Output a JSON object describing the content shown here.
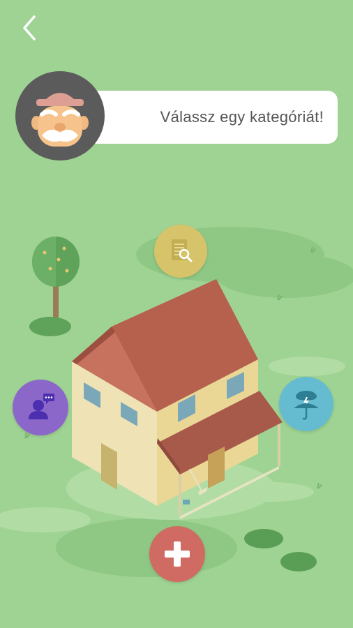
{
  "header": {
    "back_icon": "chevron-left-icon"
  },
  "assistant": {
    "avatar_icon": "old-man-avatar-icon",
    "prompt_text": "Válassz egy kategóriát!"
  },
  "categories": [
    {
      "id": "search",
      "icon": "document-search-icon",
      "color": "#d7c46a"
    },
    {
      "id": "person",
      "icon": "person-chat-icon",
      "color": "#8a67c8"
    },
    {
      "id": "weather",
      "icon": "umbrella-storm-icon",
      "color": "#65bcd0"
    },
    {
      "id": "add",
      "icon": "plus-icon",
      "color": "#cf6b62"
    }
  ]
}
